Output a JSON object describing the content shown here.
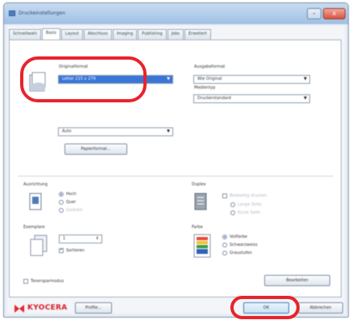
{
  "window": {
    "title": "Druckeinstellungen",
    "minimize": "-",
    "close": "x"
  },
  "tabs": [
    {
      "label": "Schnellwahl",
      "active": false
    },
    {
      "label": "Basis",
      "active": true
    },
    {
      "label": "Layout",
      "active": false
    },
    {
      "label": "Abschluss",
      "active": false
    },
    {
      "label": "Imaging",
      "active": false
    },
    {
      "label": "Publishing",
      "active": false
    },
    {
      "label": "Jobs",
      "active": false
    },
    {
      "label": "Erweitert",
      "active": false
    }
  ],
  "paper": {
    "original_size_label": "Originalformat",
    "original_size_value": "Letter 215 x 279",
    "source_value": "Auto",
    "print_size_label": "Ausgabeformat",
    "print_size_value": "Wie Original",
    "media_type_label": "Medientyp",
    "media_type_value": "Druckerstandard",
    "custom_button": "Papierformat..."
  },
  "orientation": {
    "label": "Ausrichtung",
    "options": [
      {
        "label": "Hoch",
        "selected": true
      },
      {
        "label": "Quer",
        "selected": false
      },
      {
        "label": "Gedreht",
        "selected": false
      }
    ]
  },
  "duplex": {
    "label": "Duplex",
    "options": [
      {
        "label": "Beidseitig drucken",
        "checked": false
      },
      {
        "label": "Lange Seite",
        "checked": false
      },
      {
        "label": "Kurze Seite",
        "checked": false
      }
    ]
  },
  "copies": {
    "label": "Exemplare",
    "value": "1",
    "collate_label": "Sortieren",
    "collate_checked": true
  },
  "color": {
    "label": "Farbe",
    "options": [
      {
        "label": "Vollfarbe",
        "selected": true
      },
      {
        "label": "Schwarzweiss",
        "selected": false
      },
      {
        "label": "Graustufen",
        "selected": false
      }
    ]
  },
  "eco": {
    "label": "Tonersparmodus",
    "checked": false
  },
  "edit_button": "Bearbeiten",
  "footer": {
    "brand": "KYOCERA",
    "profiles_button": "Profile...",
    "ok_button": "OK",
    "cancel_button": "Abbrechen"
  },
  "highlight_color": "#e8232b"
}
